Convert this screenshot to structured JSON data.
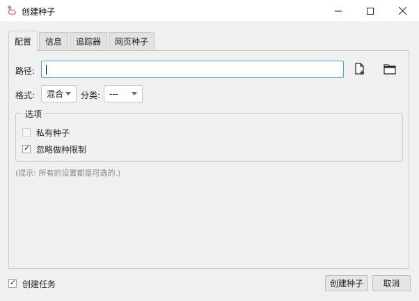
{
  "window": {
    "title": "创建种子",
    "icon": "goose-icon",
    "controls": [
      "minimize-icon",
      "maximize-icon",
      "close-icon"
    ]
  },
  "tabs": [
    {
      "label": "配置",
      "active": true
    },
    {
      "label": "信息",
      "active": false
    },
    {
      "label": "追踪器",
      "active": false
    },
    {
      "label": "网页种子",
      "active": false
    }
  ],
  "config": {
    "path_label": "路径:",
    "path_value": "",
    "new_file_icon": "new-file-icon",
    "folder_icon": "folder-icon",
    "format_label": "格式:",
    "format_value": "混合",
    "category_label": "分类:",
    "category_value": "---",
    "options": {
      "title": "选项",
      "private_label": "私有种子",
      "private_checked": false,
      "private_enabled": false,
      "ignore_limit_label": "忽略做种限制",
      "ignore_limit_checked": true
    },
    "hint": "(提示: 所有的设置都是可选的.)"
  },
  "footer": {
    "create_task_label": "创建任务",
    "create_task_checked": true,
    "create_button": "创建种子",
    "cancel_button": "取消"
  },
  "colors": {
    "accent": "#4aa2e6"
  }
}
